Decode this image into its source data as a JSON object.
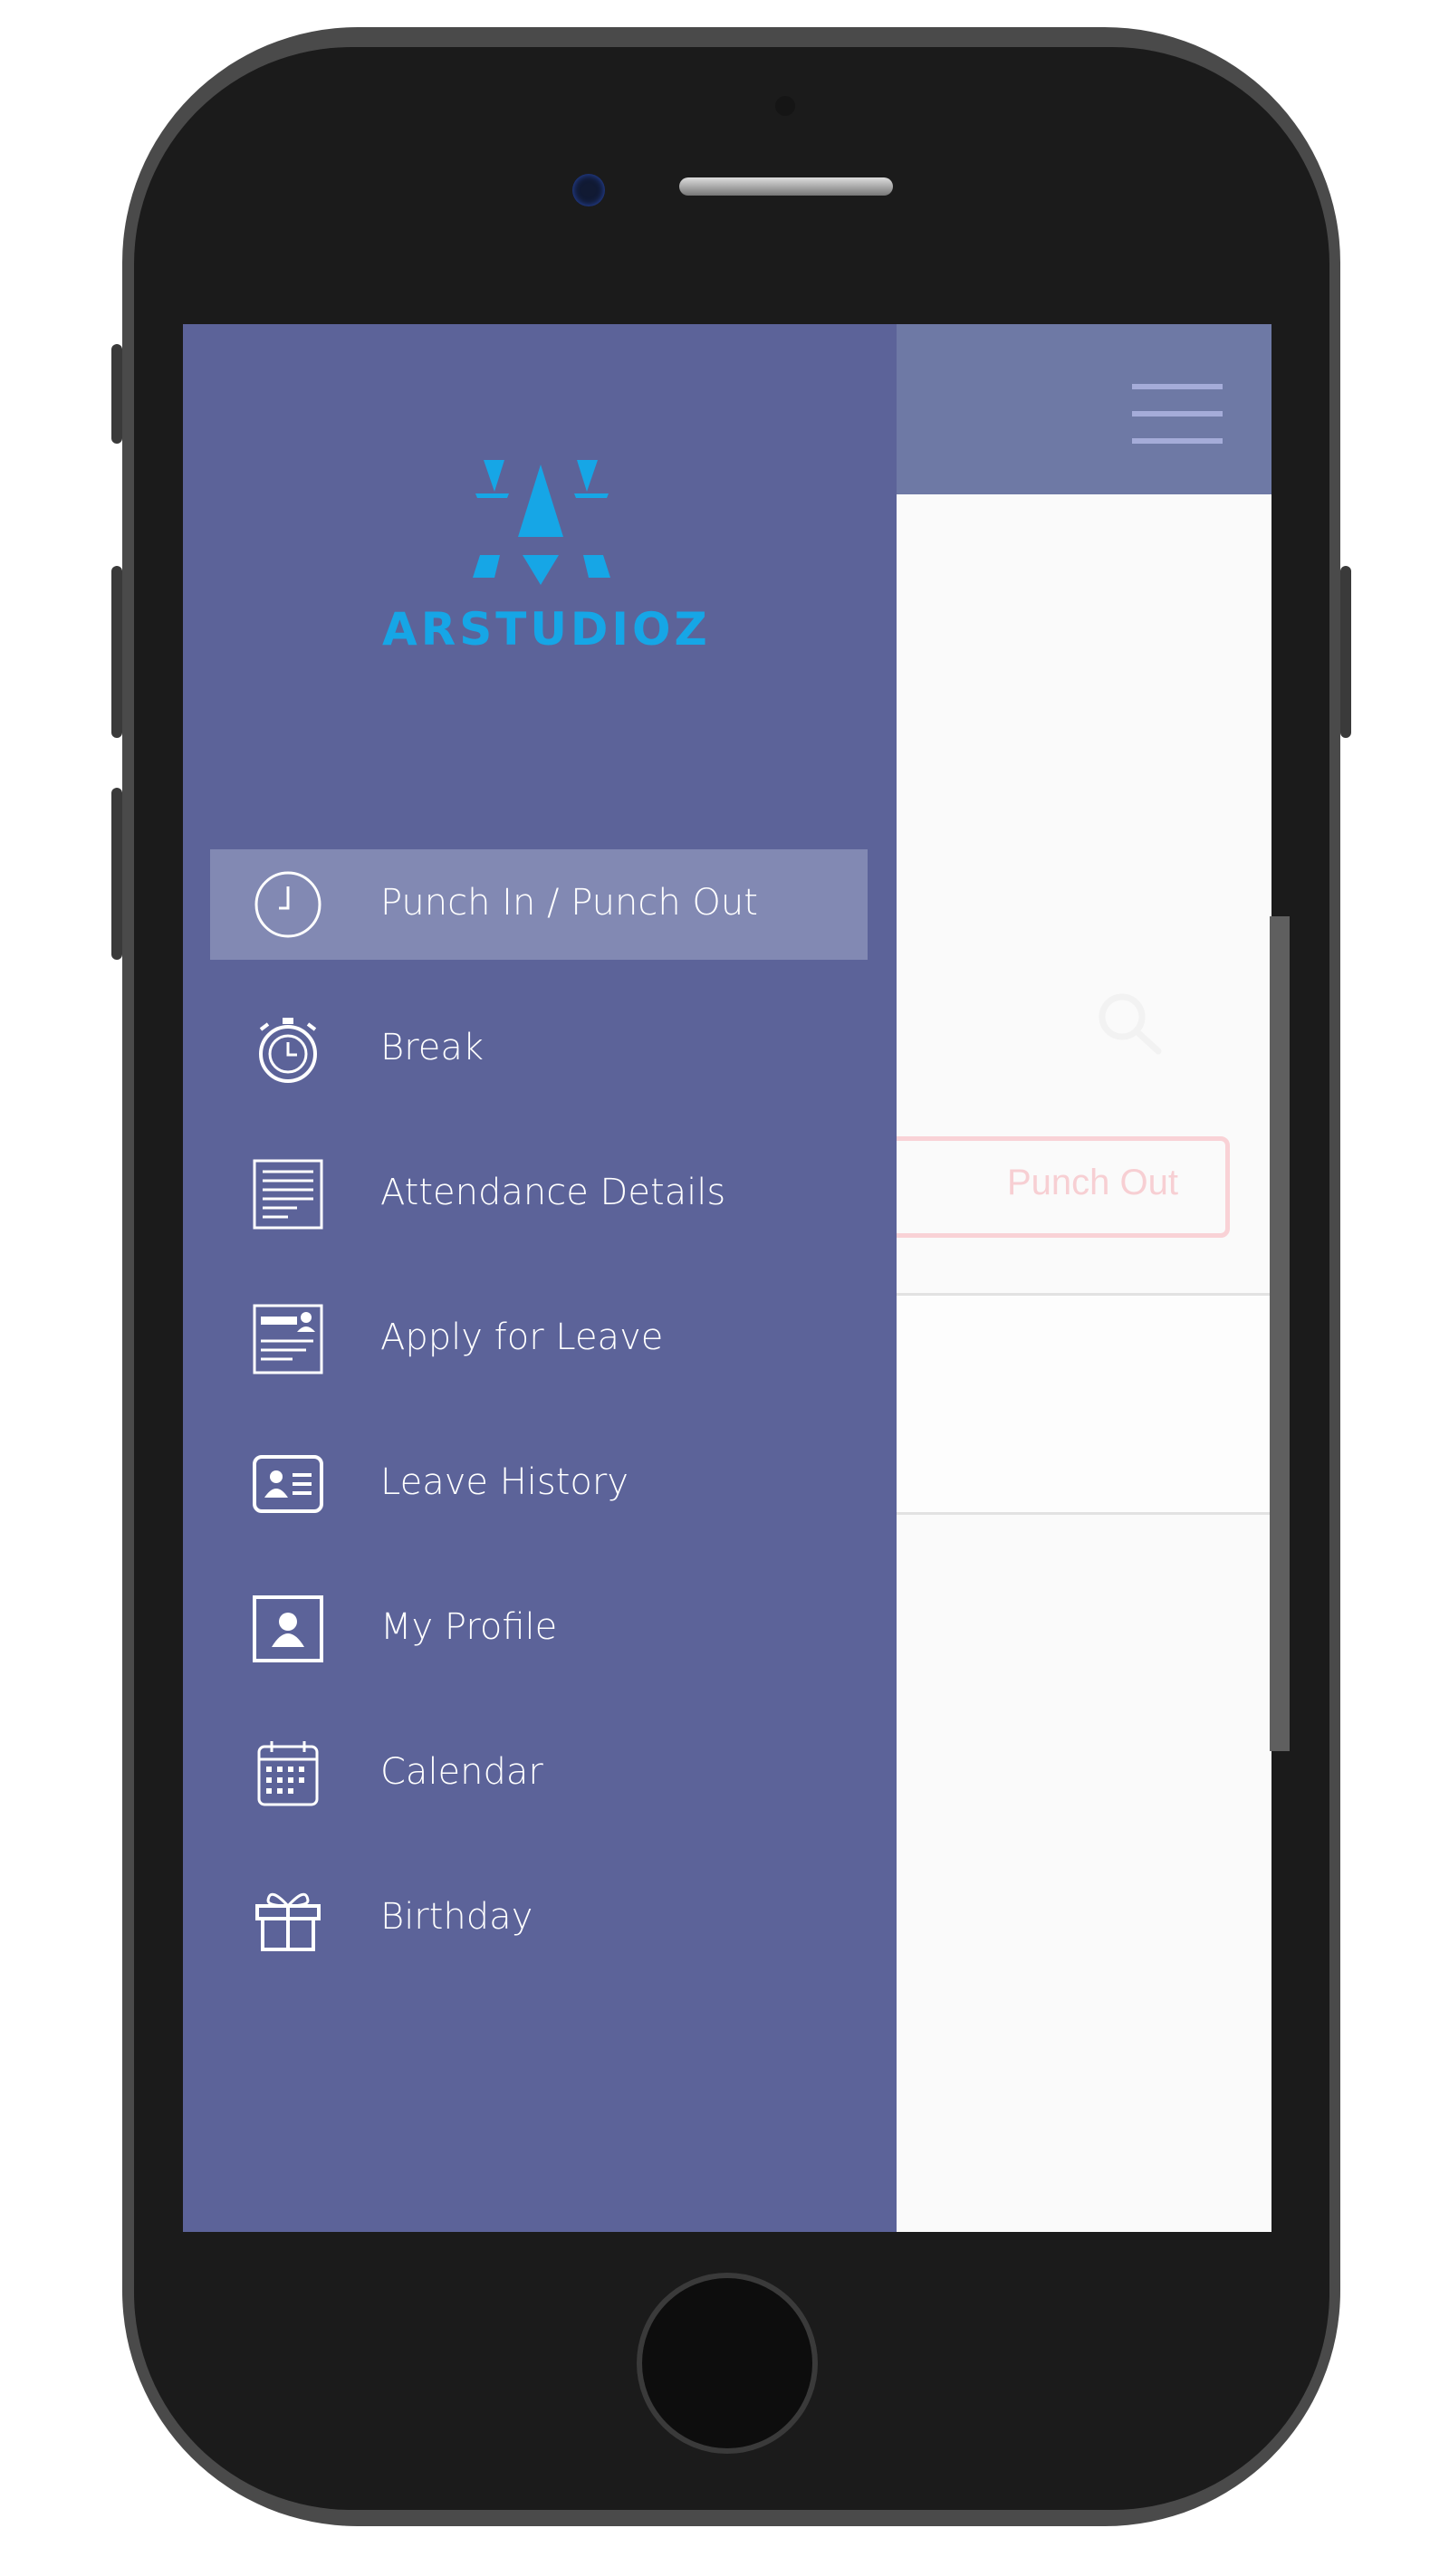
{
  "brand": {
    "name": "ARSTUDIOZ",
    "color": "#16a6e6"
  },
  "colors": {
    "drawer": "#5c6399",
    "active_item": "#8289b3",
    "header": "#6e79a5"
  },
  "drawer": {
    "active_index": 0,
    "items": [
      {
        "label": "Punch In / Punch Out",
        "icon": "clock-icon"
      },
      {
        "label": "Break",
        "icon": "stopwatch-icon"
      },
      {
        "label": "Attendance Details",
        "icon": "document-icon"
      },
      {
        "label": "Apply for Leave",
        "icon": "form-icon"
      },
      {
        "label": "Leave History",
        "icon": "id-card-icon"
      },
      {
        "label": "My Profile",
        "icon": "profile-icon"
      },
      {
        "label": "Calendar",
        "icon": "calendar-icon"
      },
      {
        "label": "Birthday",
        "icon": "gift-icon"
      }
    ]
  },
  "main": {
    "punch_button_label": "Punch Out",
    "search_icon": "search-icon",
    "menu_icon": "hamburger-icon"
  }
}
